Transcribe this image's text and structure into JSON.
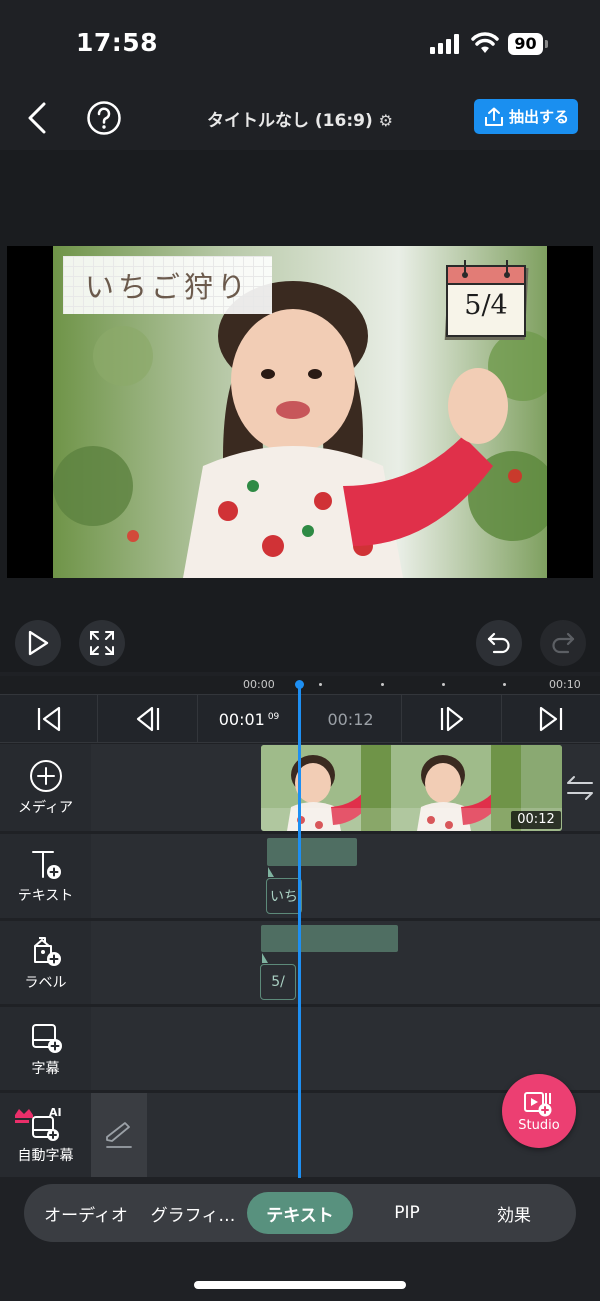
{
  "status_bar": {
    "time": "17:58",
    "battery": "90"
  },
  "header": {
    "title": "タイトルなし (16:9)",
    "export_label": "抽出する",
    "accent_color": "#1a8ff0"
  },
  "preview": {
    "title_text": "いちご狩り",
    "calendar_text": "5/4"
  },
  "ruler": {
    "start_label": "00:00",
    "end_label": "00:10"
  },
  "nav": {
    "current_time": "00:01",
    "current_frame": "09",
    "total_time": "00:12"
  },
  "tracks": {
    "media": {
      "label": "メディア",
      "duration": "00:12"
    },
    "text": {
      "label": "テキスト",
      "tag": "いち"
    },
    "label": {
      "label": "ラベル",
      "tag": "5/"
    },
    "caption": {
      "label": "字幕"
    },
    "auto_caption": {
      "label": "自動字幕",
      "badge": "AI"
    }
  },
  "studio_button": {
    "label": "Studio",
    "color": "#ec3f72"
  },
  "tabs": [
    {
      "label": "オーディオ",
      "active": false
    },
    {
      "label": "グラフィ…",
      "active": false
    },
    {
      "label": "テキスト",
      "active": true
    },
    {
      "label": "PIP",
      "active": false
    },
    {
      "label": "効果",
      "active": false
    }
  ]
}
